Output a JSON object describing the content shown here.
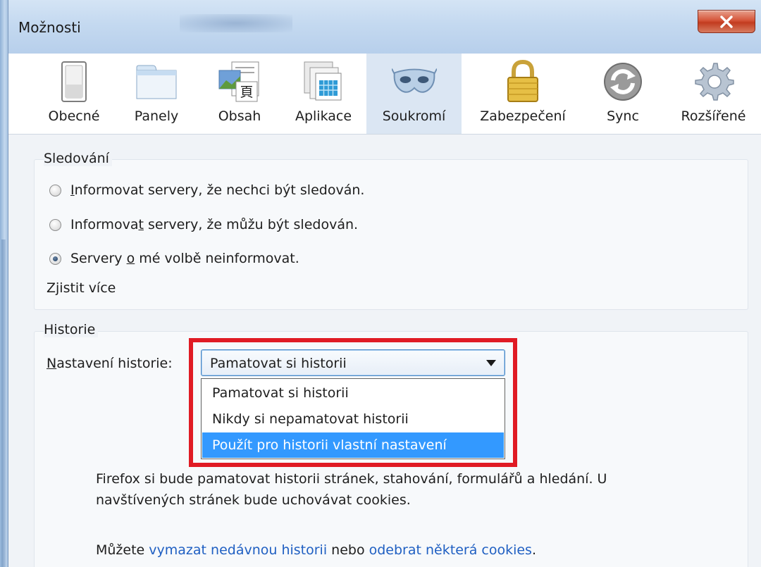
{
  "window": {
    "title": "Možnosti"
  },
  "toolbar": {
    "tabs": [
      {
        "label": "Obecné",
        "icon": "general-switch-icon"
      },
      {
        "label": "Panely",
        "icon": "tabs-window-icon"
      },
      {
        "label": "Obsah",
        "icon": "content-picture-icon"
      },
      {
        "label": "Aplikace",
        "icon": "applications-icon"
      },
      {
        "label": "Soukromí",
        "icon": "privacy-mask-icon",
        "selected": true
      },
      {
        "label": "Zabezpečení",
        "icon": "security-lock-icon"
      },
      {
        "label": "Sync",
        "icon": "sync-icon"
      },
      {
        "label": "Rozšířené",
        "icon": "advanced-gear-icon"
      }
    ]
  },
  "tracking": {
    "caption": "Sledování",
    "options": [
      {
        "access_key": "I",
        "rest": "nformovat servery, že nechci být sledován.",
        "checked": false
      },
      {
        "before": "Informova",
        "access_key": "t",
        "rest": " servery, že můžu být sledován.",
        "checked": false
      },
      {
        "before": "Servery ",
        "access_key": "o",
        "rest": " mé volbě neinformovat.",
        "checked": true
      }
    ],
    "learn_more": "Zjistit více"
  },
  "history": {
    "caption": "Historie",
    "setting_label_key": "N",
    "setting_label_rest": "astavení historie:",
    "selected_value": "Pamatovat si historii",
    "options": [
      "Pamatovat si historii",
      "Nikdy si nepamatovat historii",
      "Použít pro historii vlastní nastavení"
    ],
    "highlighted_option_index": 2,
    "description_line1": "Firefox si bude pamatovat historii stránek, stahování, formulářů a hledání. U",
    "description_line2": "navštívených stránek bude uchovávat cookies.",
    "clear_prefix": "Můžete ",
    "clear_link": "vymazat nedávnou historii",
    "clear_middle": " nebo ",
    "cookies_link": "odebrat některá cookies",
    "clear_suffix": "."
  },
  "colors": {
    "accent_highlight": "#e01b24",
    "selection": "#3399ff",
    "link": "#1f5fc2"
  }
}
